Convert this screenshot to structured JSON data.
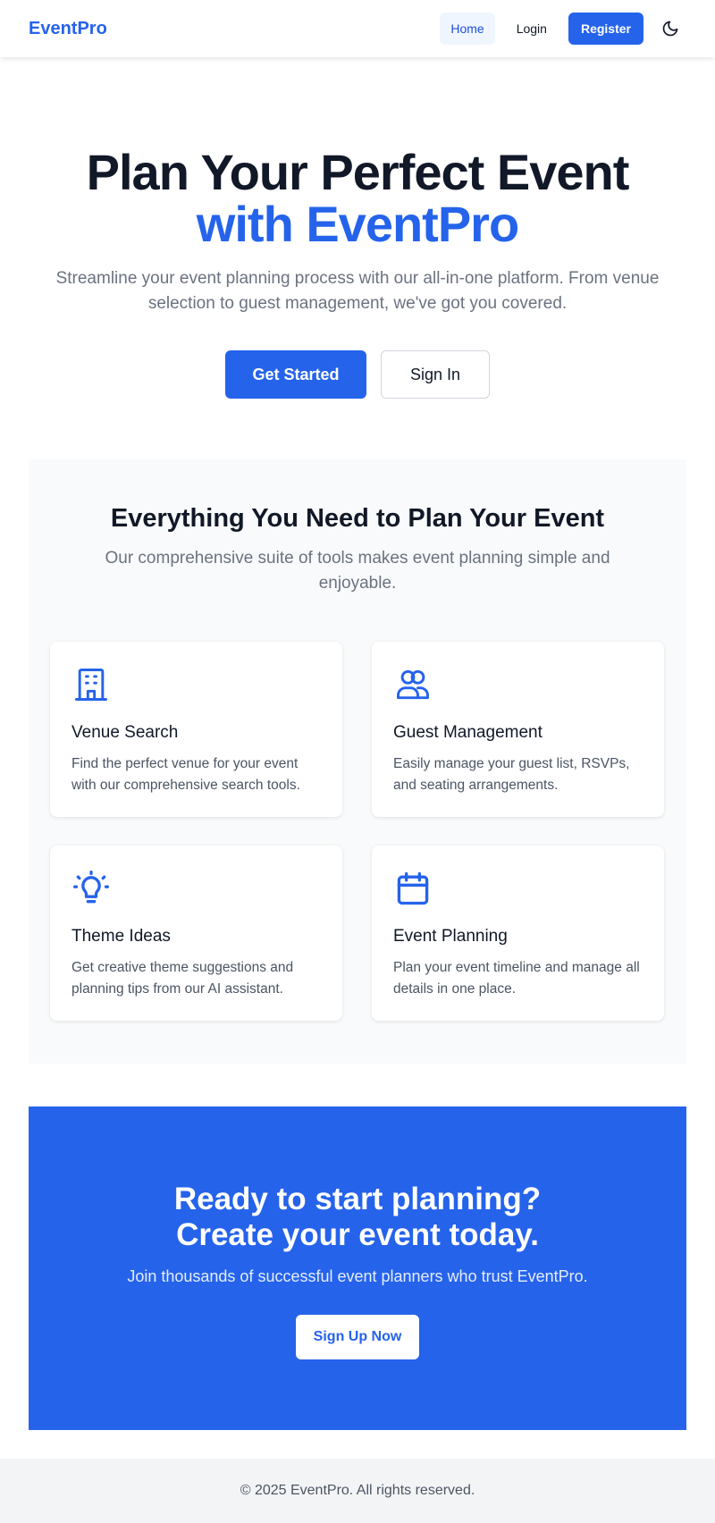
{
  "nav": {
    "brand": "EventPro",
    "links": [
      {
        "label": "Home",
        "active": true
      },
      {
        "label": "Login",
        "active": false
      }
    ],
    "register_label": "Register",
    "theme_toggle_icon": "moon-icon"
  },
  "hero": {
    "title_line1": "Plan Your Perfect Event",
    "title_line2": "with EventPro",
    "subtitle": "Streamline your event planning process with our all-in-one platform. From venue selection to guest management, we've got you covered.",
    "primary_button": "Get Started",
    "secondary_button": "Sign In"
  },
  "features": {
    "title": "Everything You Need to Plan Your Event",
    "subtitle": "Our comprehensive suite of tools makes event planning simple and enjoyable.",
    "items": [
      {
        "icon": "building-icon",
        "name": "Venue Search",
        "description": "Find the perfect venue for your event with our comprehensive search tools."
      },
      {
        "icon": "users-icon",
        "name": "Guest Management",
        "description": "Easily manage your guest list, RSVPs, and seating arrangements."
      },
      {
        "icon": "lightbulb-icon",
        "name": "Theme Ideas",
        "description": "Get creative theme suggestions and planning tips from our AI assistant."
      },
      {
        "icon": "calendar-icon",
        "name": "Event Planning",
        "description": "Plan your event timeline and manage all details in one place."
      }
    ]
  },
  "cta": {
    "title_line1": "Ready to start planning?",
    "title_line2": "Create your event today.",
    "subtitle": "Join thousands of successful event planners who trust EventPro.",
    "button": "Sign Up Now"
  },
  "footer": {
    "text": "© 2025 EventPro. All rights reserved."
  },
  "colors": {
    "primary": "#2563eb",
    "heading": "#111827",
    "muted": "#6b7280",
    "section_bg": "#f9fafb",
    "footer_bg": "#f3f4f6"
  }
}
